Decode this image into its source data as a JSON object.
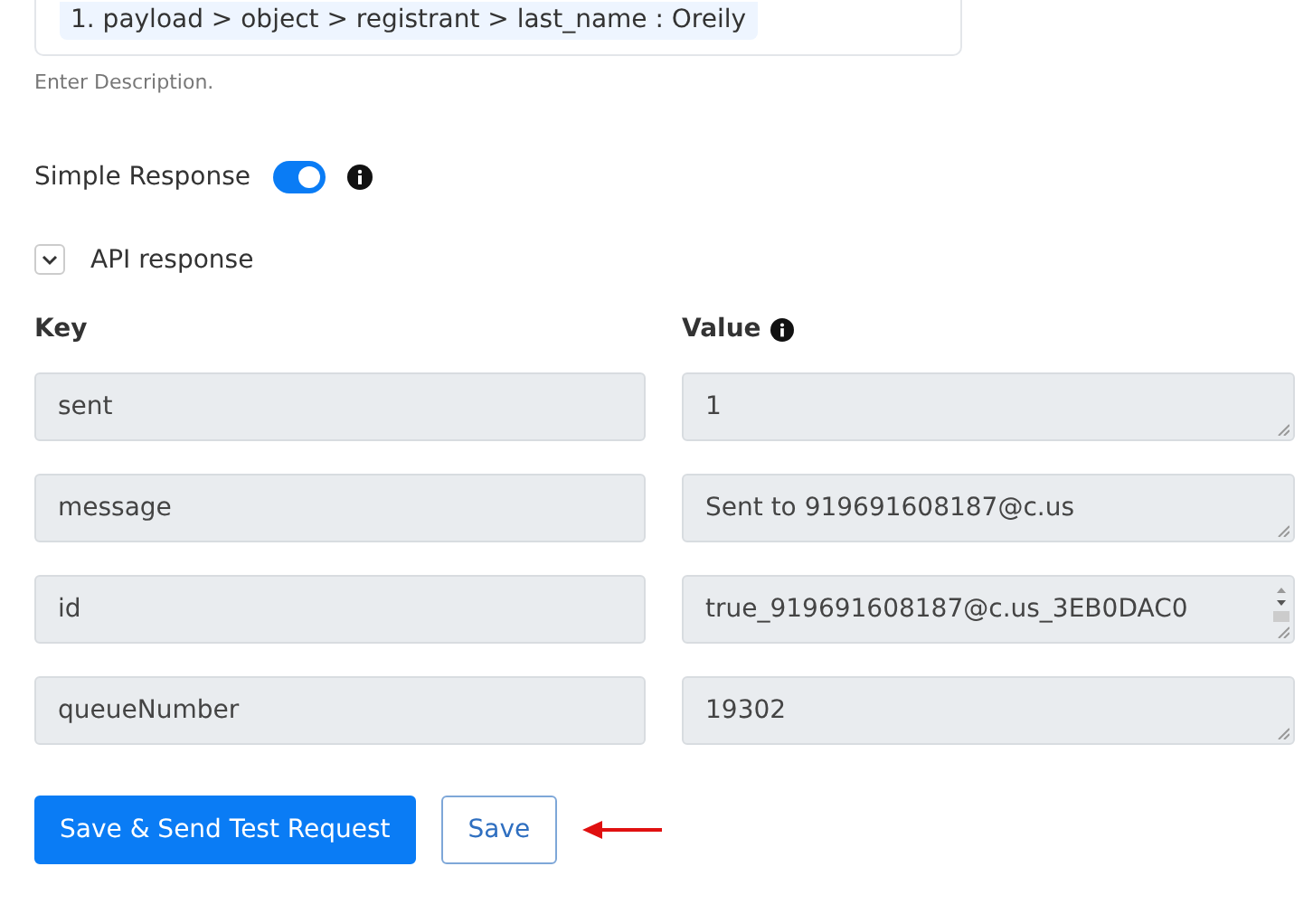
{
  "mapping_box": {
    "chips": [
      "1. payload > object > registrant > last_name : Oreily"
    ]
  },
  "description_hint": "Enter Description.",
  "simple_response": {
    "label": "Simple Response",
    "on": true
  },
  "api_response": {
    "label": "API response",
    "expanded": true
  },
  "table": {
    "columns": [
      "Key",
      "Value"
    ],
    "rows": [
      {
        "key": "sent",
        "value": "1",
        "scrollable": false
      },
      {
        "key": "message",
        "value": "Sent to 919691608187@c.us",
        "scrollable": false
      },
      {
        "key": "id",
        "value": "true_919691608187@c.us_3EB0DAC0",
        "scrollable": true
      },
      {
        "key": "queueNumber",
        "value": "19302",
        "scrollable": false
      }
    ]
  },
  "buttons": [
    {
      "label": "Save & Send Test Request",
      "kind": "primary"
    },
    {
      "label": "Save",
      "kind": "outline"
    }
  ]
}
